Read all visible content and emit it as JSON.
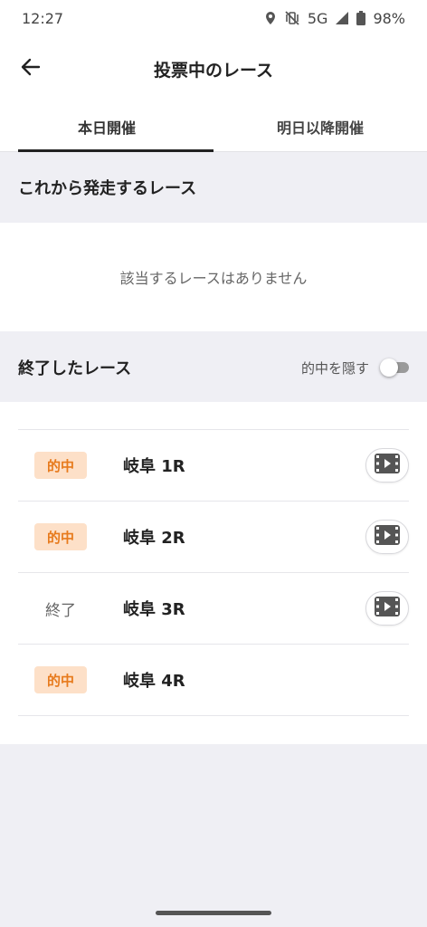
{
  "status_bar": {
    "time": "12:27",
    "network": "5G",
    "battery": "98%",
    "icons": [
      "location-icon",
      "mute-vibrate-icon",
      "signal-icon",
      "battery-icon"
    ]
  },
  "app_bar": {
    "title": "投票中のレース",
    "back_icon": "arrow-left-icon"
  },
  "tabs": [
    {
      "label": "本日開催",
      "active": true
    },
    {
      "label": "明日以降開催",
      "active": false
    }
  ],
  "upcoming": {
    "title": "これから発走するレース",
    "empty_message": "該当するレースはありません"
  },
  "finished": {
    "title": "終了したレース",
    "hide_hits_label": "的中を隠す",
    "hide_hits_on": false,
    "races": [
      {
        "status": "的中",
        "name": "岐阜 1R",
        "has_video": true
      },
      {
        "status": "的中",
        "name": "岐阜 2R",
        "has_video": true
      },
      {
        "status": "終了",
        "name": "岐阜 3R",
        "has_video": true
      },
      {
        "status": "的中",
        "name": "岐阜 4R",
        "has_video": false
      }
    ]
  },
  "colors": {
    "hit_badge_bg": "#fde0c8",
    "hit_badge_text": "#e77a1c",
    "page_bg": "#efeff4"
  }
}
